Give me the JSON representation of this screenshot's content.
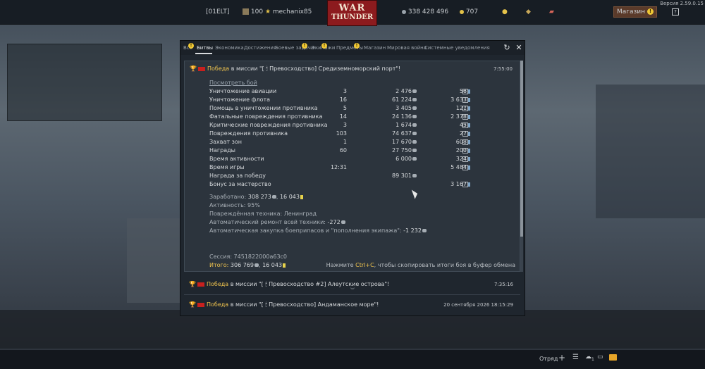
{
  "version": "Версия 2.59.0.15",
  "topbar": {
    "squad_tag": "[01ELT]",
    "level": "100",
    "username": "mechanix85",
    "logo_line1": "WAR",
    "logo_line2": "THUNDER",
    "silver_lions": "338 428 496",
    "golden_eagles": "707",
    "shop_label": "Магазин",
    "shop_badge": "!",
    "help": "?"
  },
  "tabs": [
    {
      "label": "Все",
      "badge": "!"
    },
    {
      "label": "Битвы",
      "active": true
    },
    {
      "label": "Экономика"
    },
    {
      "label": "Достижения"
    },
    {
      "label": "Боевые задачи",
      "badge": "!"
    },
    {
      "label": "Экипажи",
      "badge": "!"
    },
    {
      "label": "Предметы",
      "badge": "!"
    },
    {
      "label": "Магазин"
    },
    {
      "label": "Мировая война"
    },
    {
      "label": "Системные уведомления"
    }
  ],
  "message": {
    "result": "Победа",
    "mission": "в миссии \"[ 🕯 Превосходство] Средиземноморский порт\"!",
    "time": "7:55:00",
    "view_battle": "Посмотреть бой",
    "rows": [
      {
        "label": "Уничтожение авиации",
        "count": "3",
        "sl": "2 476",
        "rp": "56",
        "help": "?"
      },
      {
        "label": "Уничтожение флота",
        "count": "16",
        "sl": "61 224",
        "rp": "3 633",
        "help": "?"
      },
      {
        "label": "Помощь в уничтожении противника",
        "count": "5",
        "sl": "3 405",
        "rp": "121",
        "help": "?"
      },
      {
        "label": "Фатальные повреждения противника",
        "count": "14",
        "sl": "24 136",
        "rp": "2 378",
        "help": "?"
      },
      {
        "label": "Критические повреждения противника",
        "count": "3",
        "sl": "1 674",
        "rp": "45",
        "help": "?"
      },
      {
        "label": "Повреждения противника",
        "count": "103",
        "sl": "74 637",
        "rp": "27",
        "help": "?"
      },
      {
        "label": "Захват зон",
        "count": "1",
        "sl": "17 670",
        "rp": "608",
        "help": "?"
      },
      {
        "label": "Награды",
        "count": "60",
        "sl": "27 750",
        "rp": "200",
        "help": "?"
      },
      {
        "label": "Время активности",
        "count": "",
        "sl": "6 000",
        "rp": "324",
        "help": "?"
      },
      {
        "label": "Время игры",
        "count": "12:31",
        "sl": "",
        "rp": "5 484",
        "help": "?"
      },
      {
        "label": "Награда за победу",
        "count": "",
        "sl": "89 301",
        "rp": "",
        "help": ""
      },
      {
        "label": "Бонус за мастерство",
        "count": "",
        "sl": "",
        "rp": "3 167",
        "help": "?"
      }
    ],
    "earned_label": "Заработано:",
    "earned_sl": "308 273",
    "earned_rp": "16 043",
    "activity": "Активность: 95%",
    "damaged_vehicles": "Повреждённая техника: Ленинград",
    "auto_repair_label": "Автоматический ремонт всей техники:",
    "auto_repair_value": "-272",
    "auto_buy_label": "Автоматическая закупка боеприпасов и \"пополнения экипажа\":",
    "auto_buy_value": "-1 232",
    "session": "Сессия: 7451822000a63c0",
    "total_label": "Итого:",
    "total_sl": "306 769",
    "total_rp": "16 043",
    "hint_pre": "Нажмите ",
    "hint_key": "Ctrl+C",
    "hint_post": ", чтобы скопировать итоги боя в буфер обмена"
  },
  "messages_collapsed": [
    {
      "result": "Победа",
      "mission": "в миссии \"[ 🕯 Превосходство #2] Алеутские острова\"!",
      "time": "7:35:16"
    },
    {
      "result": "Победа",
      "mission": "в миссии \"[ 🕯 Превосходство] Андаманское море\"!",
      "time": "20 сентября 2026 18:15:29"
    }
  ],
  "bottombar": {
    "squad_label": "Отряд",
    "plus": "+",
    "friends_count": "1"
  }
}
